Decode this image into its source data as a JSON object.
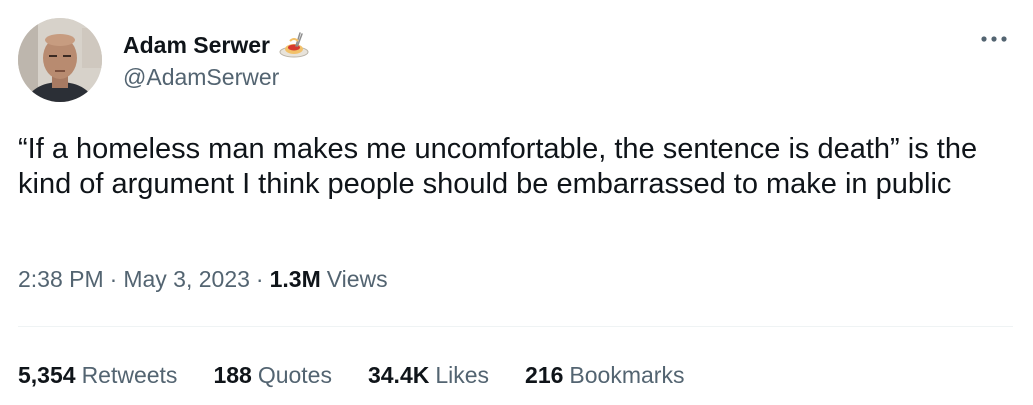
{
  "author": {
    "name": "Adam Serwer",
    "handle": "@AdamSerwer",
    "name_emoji_icon": "spaghetti-plate-icon"
  },
  "menu_icon": "more-horizontal-icon",
  "tweet": {
    "text": "“If a homeless man makes me uncomfortable, the sentence is death” is the kind of argument I think people should be embarrassed to make in public"
  },
  "meta": {
    "time": "2:38 PM",
    "separator": "·",
    "date": "May 3, 2023",
    "views_count": "1.3M",
    "views_label": "Views"
  },
  "stats": [
    {
      "count": "5,354",
      "label": "Retweets"
    },
    {
      "count": "188",
      "label": "Quotes"
    },
    {
      "count": "34.4K",
      "label": "Likes"
    },
    {
      "count": "216",
      "label": "Bookmarks"
    }
  ],
  "colors": {
    "text_primary": "#0f1419",
    "text_secondary": "#536471",
    "divider": "#eff3f4",
    "background": "#ffffff"
  }
}
